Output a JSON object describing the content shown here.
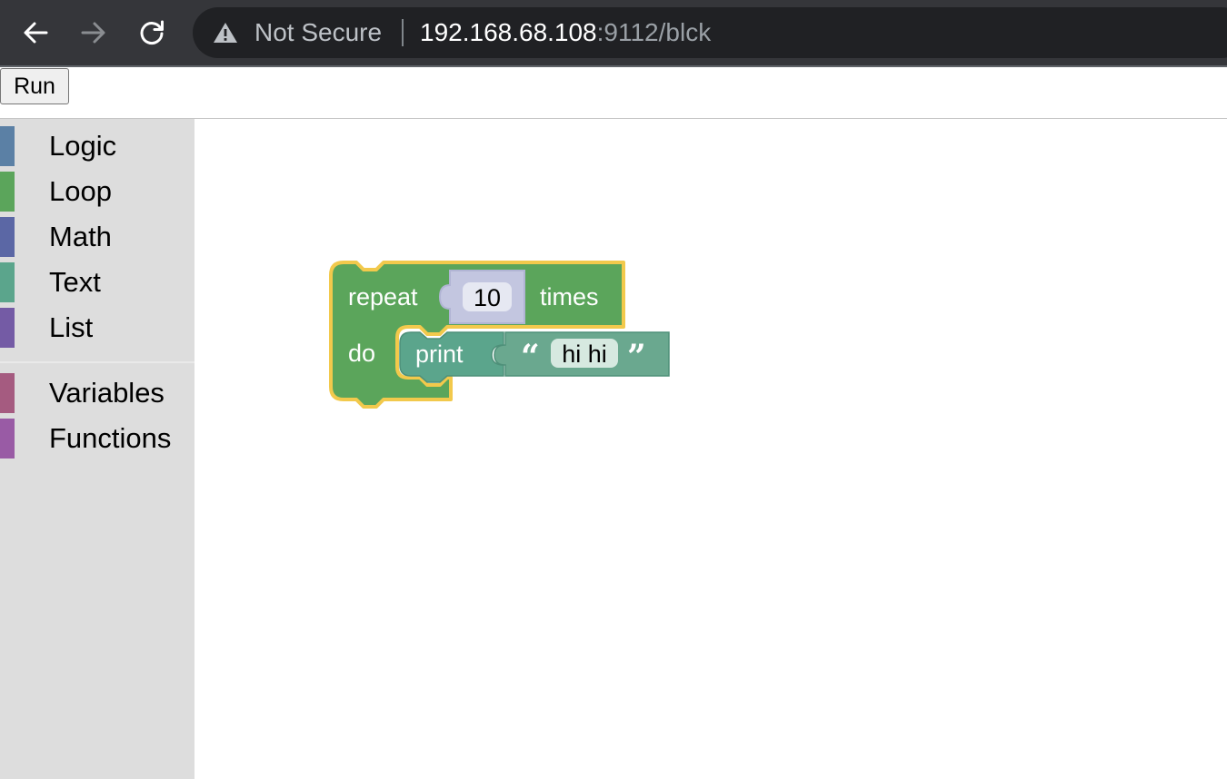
{
  "browser": {
    "security_label": "Not Secure",
    "url_host": "192.168.68.108",
    "url_rest": ":9112/blck",
    "icons": [
      "back-icon",
      "forward-icon",
      "reload-icon",
      "warning-icon"
    ]
  },
  "toolbar": {
    "run_label": "Run"
  },
  "toolbox": {
    "categories": [
      {
        "label": "Logic",
        "color": "#5b80a5"
      },
      {
        "label": "Loop",
        "color": "#5ba55b"
      },
      {
        "label": "Math",
        "color": "#5b67a5"
      },
      {
        "label": "Text",
        "color": "#5ba58c"
      },
      {
        "label": "List",
        "color": "#745ba5"
      },
      {
        "label": "Variables",
        "color": "#a55b80"
      },
      {
        "label": "Functions",
        "color": "#995ba5"
      }
    ]
  },
  "workspace": {
    "repeat_block": {
      "label_repeat": "repeat",
      "count": "10",
      "label_times": "times",
      "label_do": "do",
      "color": "#5ba55b",
      "selected_outline": "#f2c94c"
    },
    "print_block": {
      "label": "print",
      "color": "#5ba58c"
    },
    "text_block": {
      "open_quote": "“",
      "value": "hi hi",
      "close_quote": "”",
      "color": "#5ba58c"
    },
    "number_block": {
      "color": "#5b67a5"
    }
  }
}
